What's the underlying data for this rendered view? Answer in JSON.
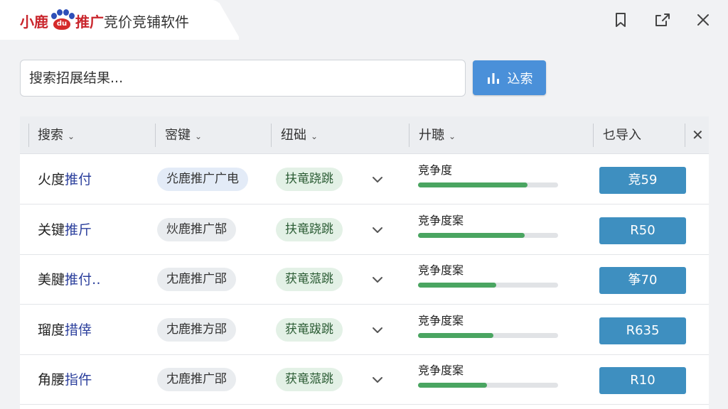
{
  "app": {
    "brand_red_1": "小鹿",
    "brand_paw_text": "du",
    "brand_red_2": "推广",
    "brand_rest": "竞价竞铺软件"
  },
  "window_icons": [
    "bookmark-icon",
    "share-icon",
    "close-icon"
  ],
  "search": {
    "placeholder": "搜索招展结果...",
    "button_label": "込索"
  },
  "columns": [
    {
      "label": "搜索"
    },
    {
      "label": "宻键"
    },
    {
      "label": "纽础"
    },
    {
      "label": "廾聴"
    },
    {
      "label": "乜导入"
    }
  ],
  "rows": [
    {
      "name_a": "火度",
      "name_b": "推付",
      "keyword": "灮鹿推广广电",
      "status": "扶竜跷跳",
      "competition_label": "竞争度",
      "competition": 0.78,
      "price": "竞59"
    },
    {
      "name_a": "关键",
      "name_b": "推斤",
      "keyword": "炏鹿推广郜",
      "status": "扶竜跷跳",
      "competition_label": "竞争度案",
      "competition": 0.76,
      "price": "R50"
    },
    {
      "name_a": "美腱",
      "name_b": "推付‥",
      "keyword": "冘鹿推广郘",
      "status": "获竜蒎跳",
      "competition_label": "竞争度案",
      "competition": 0.56,
      "price": "筝70"
    },
    {
      "name_a": "瑠度",
      "name_b": "措倖",
      "keyword": "冘鹿推方郘",
      "status": "获竜跋跳",
      "competition_label": "竞争度案",
      "competition": 0.54,
      "price": "R635"
    },
    {
      "name_a": "角腰",
      "name_b": "指仵",
      "keyword": "冘鹿推广郘",
      "status": "获竜蒎跳",
      "competition_label": "竞争度案",
      "competition": 0.49,
      "price": "R10"
    }
  ],
  "colors": {
    "brand_red": "#c9252c",
    "accent_blue": "#4a90d9",
    "progress_green": "#4aa561",
    "price_blue": "#3e8fc0"
  }
}
